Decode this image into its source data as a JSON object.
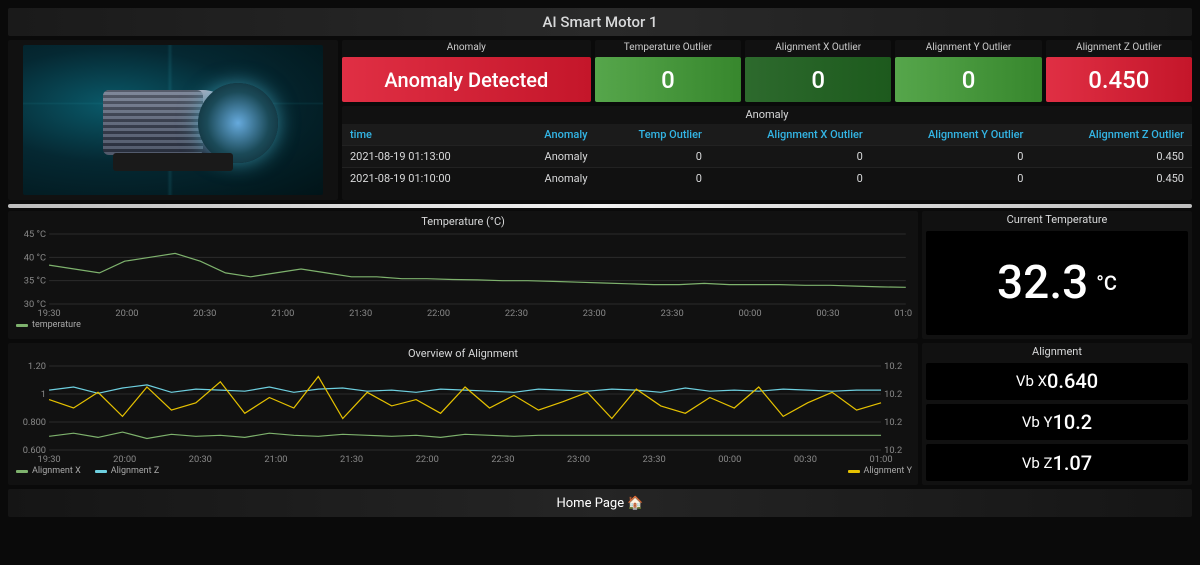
{
  "header": {
    "title": "AI Smart Motor 1"
  },
  "kpis": {
    "anomaly": {
      "title": "Anomaly",
      "value": "Anomaly Detected",
      "status": "red"
    },
    "temp_outlier": {
      "title": "Temperature Outlier",
      "value": "0",
      "status": "green"
    },
    "align_x": {
      "title": "Alignment X Outlier",
      "value": "0",
      "status": "darkgreen"
    },
    "align_y": {
      "title": "Alignment Y Outlier",
      "value": "0",
      "status": "green"
    },
    "align_z": {
      "title": "Alignment Z Outlier",
      "value": "0.450",
      "status": "red"
    }
  },
  "anomaly_table": {
    "title": "Anomaly",
    "headers": [
      "time",
      "Anomaly",
      "Temp Outlier",
      "Alignment X Outlier",
      "Alignment Y Outlier",
      "Alignment Z Outlier"
    ],
    "rows": [
      [
        "2021-08-19 01:13:00",
        "Anomaly",
        "0",
        "0",
        "0",
        "0.450"
      ],
      [
        "2021-08-19 01:10:00",
        "Anomaly",
        "0",
        "0",
        "0",
        "0.450"
      ]
    ]
  },
  "chart_data": [
    {
      "id": "temperature",
      "type": "line",
      "title": "Temperature (°C)",
      "ylabel": "°C",
      "ylim": [
        28,
        46
      ],
      "yticks": [
        "30 °C",
        "35 °C",
        "40 °C",
        "45 °C"
      ],
      "x_categories": [
        "19:30",
        "20:00",
        "20:30",
        "21:00",
        "21:30",
        "22:00",
        "22:30",
        "23:00",
        "23:30",
        "00:00",
        "00:30",
        "01:00"
      ],
      "series": [
        {
          "name": "temperature",
          "color": "#7eb26d",
          "values": [
            38,
            37,
            36,
            39,
            40,
            41,
            39,
            36,
            35,
            36,
            37,
            36,
            35,
            35,
            34.5,
            34.5,
            34.3,
            34.2,
            34.0,
            34,
            33.8,
            33.6,
            33.4,
            33.2,
            33.0,
            33.0,
            33.3,
            33.0,
            33.0,
            33.0,
            32.8,
            32.8,
            32.6,
            32.4,
            32.3
          ]
        }
      ]
    },
    {
      "id": "alignment",
      "type": "line",
      "title": "Overview of Alignment",
      "ylim_left": [
        0.5,
        1.3
      ],
      "ylim_right": [
        10.1,
        10.25
      ],
      "yticks_left": [
        "0.600",
        "0.800",
        "1",
        "1.20"
      ],
      "yticks_right": [
        "10.2",
        "10.2",
        "10.2",
        "10.2"
      ],
      "x_categories": [
        "19:30",
        "20:00",
        "20:30",
        "21:00",
        "21:30",
        "22:00",
        "22:30",
        "23:00",
        "23:30",
        "00:00",
        "00:30",
        "01:00"
      ],
      "series": [
        {
          "name": "Alignment X",
          "color": "#7eb26d",
          "values": [
            0.63,
            0.66,
            0.62,
            0.67,
            0.61,
            0.65,
            0.63,
            0.64,
            0.62,
            0.66,
            0.64,
            0.63,
            0.65,
            0.64,
            0.63,
            0.64,
            0.62,
            0.65,
            0.64,
            0.63,
            0.64,
            0.64,
            0.64,
            0.64,
            0.64,
            0.64,
            0.64,
            0.64,
            0.64,
            0.64,
            0.64,
            0.64,
            0.64,
            0.64,
            0.64
          ]
        },
        {
          "name": "Alignment Z",
          "color": "#6ed0e0",
          "values": [
            1.07,
            1.1,
            1.04,
            1.09,
            1.12,
            1.05,
            1.08,
            1.07,
            1.06,
            1.1,
            1.05,
            1.08,
            1.09,
            1.06,
            1.07,
            1.05,
            1.08,
            1.07,
            1.06,
            1.05,
            1.08,
            1.07,
            1.06,
            1.08,
            1.07,
            1.05,
            1.09,
            1.06,
            1.07,
            1.06,
            1.08,
            1.07,
            1.06,
            1.07,
            1.07
          ]
        },
        {
          "name": "Alignment Y",
          "color": "#e5c100",
          "values": [
            0.98,
            0.9,
            1.05,
            0.82,
            1.1,
            0.88,
            0.95,
            1.15,
            0.85,
            1.0,
            0.9,
            1.2,
            0.8,
            1.05,
            0.92,
            0.98,
            0.85,
            1.1,
            0.9,
            1.02,
            0.88,
            0.96,
            1.05,
            0.8,
            1.08,
            0.92,
            0.85,
            1.0,
            0.9,
            1.1,
            0.82,
            0.95,
            1.05,
            0.88,
            0.95
          ]
        }
      ]
    }
  ],
  "current_temperature": {
    "title": "Current Temperature",
    "value": "32.3",
    "unit": "°C"
  },
  "alignment_values": {
    "title": "Alignment",
    "rows": [
      {
        "label": "Vb X",
        "value": "0.640"
      },
      {
        "label": "Vb Y",
        "value": "10.2"
      },
      {
        "label": "Vb Z",
        "value": "1.07"
      }
    ]
  },
  "footer": {
    "label": "Home Page 🏠"
  },
  "colors": {
    "red": "#e02f44",
    "green": "#56a64b",
    "darkgreen": "#2d6a2d",
    "link": "#33b5e5",
    "temp_line": "#7eb26d",
    "align_x": "#7eb26d",
    "align_z": "#6ed0e0",
    "align_y": "#e5c100"
  }
}
